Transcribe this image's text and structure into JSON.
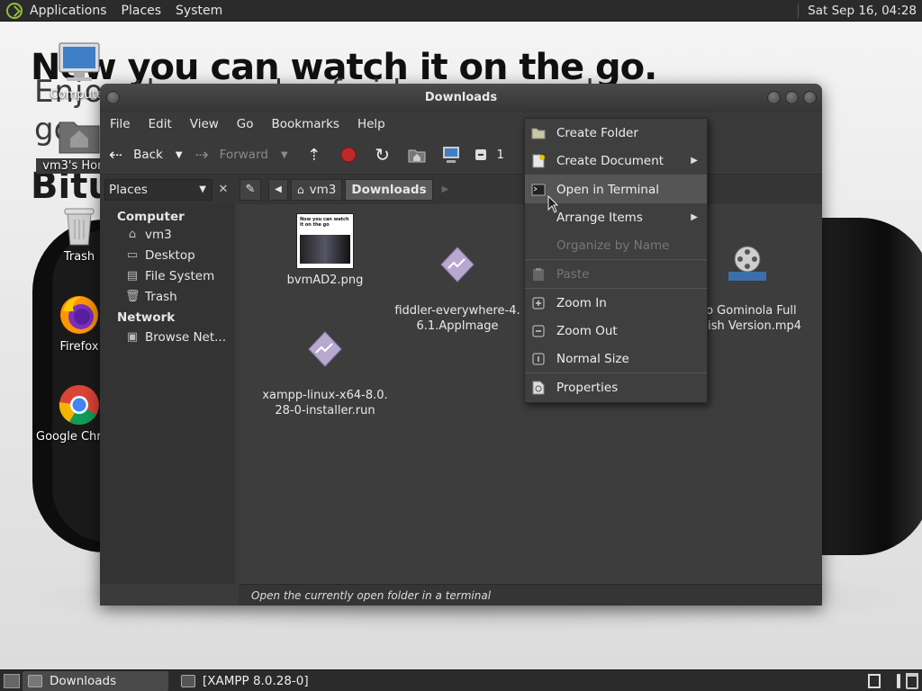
{
  "top_panel": {
    "menus": [
      "Applications",
      "Places",
      "System"
    ],
    "clock": "Sat Sep 16, 04:28"
  },
  "wallpaper": {
    "headline": "New you can watch it on the go.",
    "line2": "Enjoy thousands of videos everywhere you",
    "line3": "go",
    "line4": "Bitu"
  },
  "desktop_icons": [
    {
      "label": "Computer"
    },
    {
      "label": "vm3's Home"
    },
    {
      "label": "Trash"
    },
    {
      "label": "Firefox"
    },
    {
      "label": "Google Chrome"
    }
  ],
  "window": {
    "title": "Downloads",
    "menubar": [
      "File",
      "Edit",
      "View",
      "Go",
      "Bookmarks",
      "Help"
    ],
    "toolbar": {
      "back_label": "Back",
      "forward_label": "Forward",
      "extra_label": "1"
    },
    "location": {
      "places_label": "Places",
      "crumbs": [
        "vm3",
        "Downloads"
      ]
    },
    "sidebar": {
      "computer_head": "Computer",
      "computer_items": [
        "vm3",
        "Desktop",
        "File System",
        "Trash"
      ],
      "network_head": "Network",
      "network_items": [
        "Browse Net..."
      ]
    },
    "files": [
      {
        "name": "bvmAD2.png"
      },
      {
        "name": "fiddler-everywhere-4.\n6.1.AppImage"
      },
      {
        "name": "ito Gominola Full\nanish Version.mp4"
      },
      {
        "name": "xampp-linux-x64-8.0.\n28-0-installer.run"
      }
    ],
    "thumbnail_text": "Now you can watch it on the go",
    "status": "Open the currently open folder in a terminal"
  },
  "context_menu": {
    "items": [
      {
        "label": "Create Folder",
        "icon": "folder-new-icon"
      },
      {
        "label": "Create Document",
        "icon": "document-new-icon"
      },
      {
        "label": "Open in Terminal",
        "icon": "terminal-icon"
      },
      {
        "label": "Arrange Items",
        "icon": "none"
      },
      {
        "label": "Organize by Name",
        "icon": "none"
      },
      {
        "label": "Paste",
        "icon": "paste-icon"
      },
      {
        "label": "Zoom In",
        "icon": "zoom-in-icon"
      },
      {
        "label": "Zoom Out",
        "icon": "zoom-out-icon"
      },
      {
        "label": "Normal Size",
        "icon": "zoom-normal-icon"
      },
      {
        "label": "Properties",
        "icon": "properties-icon"
      }
    ]
  },
  "bottom_panel": {
    "tasks": [
      "Downloads",
      "[XAMPP 8.0.28-0]"
    ]
  }
}
